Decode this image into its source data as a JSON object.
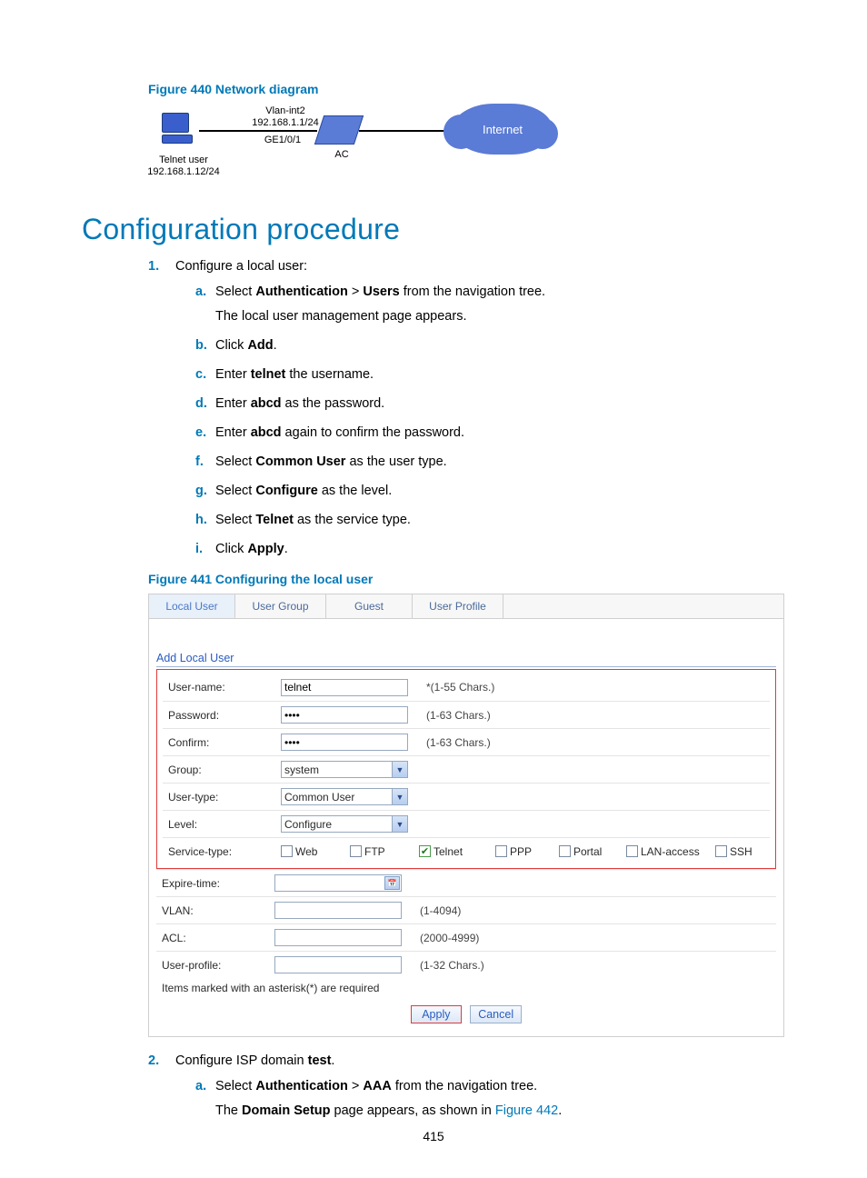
{
  "figure440_caption": "Figure 440 Network diagram",
  "diagram": {
    "telnet_user": "Telnet user",
    "telnet_ip": "192.168.1.12/24",
    "vlan": "Vlan-int2",
    "vlan_ip": "192.168.1.1/24",
    "port": "GE1/0/1",
    "ac": "AC",
    "internet": "Internet"
  },
  "section_title": "Configuration procedure",
  "step1": {
    "num": "1.",
    "text": "Configure a local user:",
    "a_let": "a.",
    "a_text1": "Select ",
    "a_b1": "Authentication",
    "a_gt": " > ",
    "a_b2": "Users",
    "a_text2": " from the navigation tree.",
    "a_extra": "The local user management page appears.",
    "b_let": "b.",
    "b_text1": "Click ",
    "b_b": "Add",
    "b_dot": ".",
    "c_let": "c.",
    "c_text1": "Enter ",
    "c_b": "telnet",
    "c_text2": " the username.",
    "d_let": "d.",
    "d_text1": "Enter ",
    "d_b": "abcd",
    "d_text2": " as the password.",
    "e_let": "e.",
    "e_text1": "Enter ",
    "e_b": "abcd",
    "e_text2": " again to confirm the password.",
    "f_let": "f.",
    "f_text1": "Select ",
    "f_b": "Common User",
    "f_text2": " as the user type.",
    "g_let": "g.",
    "g_text1": "Select ",
    "g_b": "Configure",
    "g_text2": " as the level.",
    "h_let": "h.",
    "h_text1": "Select ",
    "h_b": "Telnet",
    "h_text2": " as the service type.",
    "i_let": "i.",
    "i_text1": "Click ",
    "i_b": "Apply",
    "i_dot": "."
  },
  "figure441_caption": "Figure 441 Configuring the local user",
  "ui": {
    "tabs": {
      "local": "Local User",
      "group": "User Group",
      "guest": "Guest",
      "profile": "User Profile"
    },
    "heading": "Add Local User",
    "labels": {
      "username": "User-name:",
      "password": "Password:",
      "confirm": "Confirm:",
      "group": "Group:",
      "usertype": "User-type:",
      "level": "Level:",
      "service": "Service-type:",
      "expire": "Expire-time:",
      "vlan": "VLAN:",
      "acl": "ACL:",
      "userprofile": "User-profile:"
    },
    "values": {
      "username": "telnet",
      "password": "••••",
      "confirm": "••••",
      "group": "system",
      "usertype": "Common User",
      "level": "Configure"
    },
    "hints": {
      "username": "*(1-55 Chars.)",
      "password": "(1-63 Chars.)",
      "confirm": "(1-63 Chars.)",
      "vlan": "(1-4094)",
      "acl": "(2000-4999)",
      "userprofile": "(1-32 Chars.)"
    },
    "services": {
      "web": "Web",
      "ftp": "FTP",
      "telnet": "Telnet",
      "ppp": "PPP",
      "portal": "Portal",
      "lan": "LAN-access",
      "ssh": "SSH"
    },
    "footnote": "Items marked with an asterisk(*) are required",
    "apply": "Apply",
    "cancel": "Cancel"
  },
  "step2": {
    "num": "2.",
    "text1": "Configure ISP domain ",
    "b": "test",
    "dot": ".",
    "a_let": "a.",
    "a_text1": "Select ",
    "a_b1": "Authentication",
    "a_gt": " > ",
    "a_b2": "AAA",
    "a_text2": " from the navigation tree.",
    "a_extra1": "The ",
    "a_extra_b": "Domain Setup",
    "a_extra2": " page appears, as shown in ",
    "a_link": "Figure 442",
    "a_extra3": "."
  },
  "page_number": "415"
}
